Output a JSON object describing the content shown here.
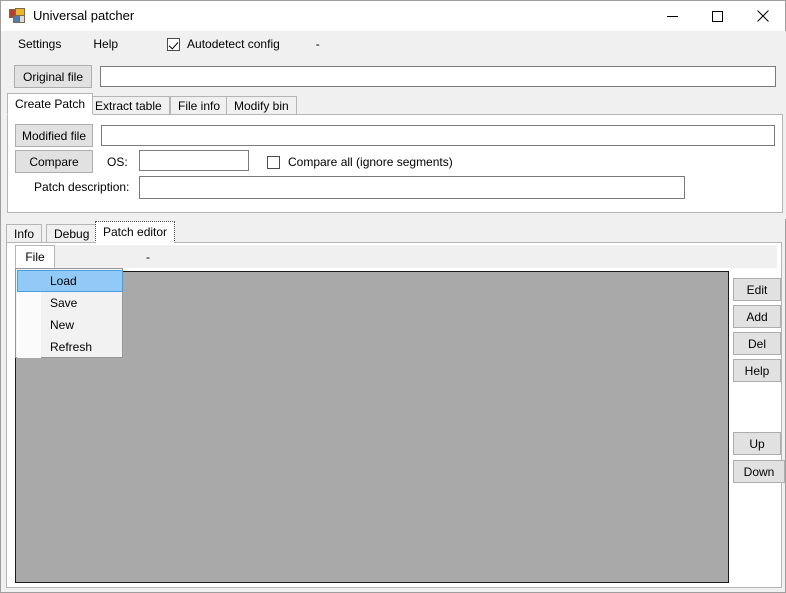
{
  "window": {
    "title": "Universal patcher",
    "icon": "app-icon",
    "controls": {
      "minimize": "minimize-icon",
      "maximize": "maximize-icon",
      "close": "close-icon"
    }
  },
  "menubar": {
    "items": [
      {
        "label": "Settings"
      },
      {
        "label": "Help"
      }
    ],
    "autodetect": {
      "label": "Autodetect config",
      "checked": true
    },
    "dash": "-"
  },
  "upper": {
    "original_file_button": "Original file",
    "original_file_value": "",
    "original_file_placeholder": "",
    "tabs": [
      {
        "label": "Create Patch",
        "selected": true
      },
      {
        "label": "Extract table",
        "selected": false
      },
      {
        "label": "File info",
        "selected": false
      },
      {
        "label": "Modify bin",
        "selected": false
      }
    ],
    "modified_file_button": "Modified file",
    "modified_file_value": "",
    "compare_button": "Compare",
    "os_label": "OS:",
    "os_value": "",
    "compare_all": {
      "label": "Compare all (ignore segments)",
      "checked": false
    },
    "patch_description_label": "Patch description:",
    "patch_description_value": ""
  },
  "lower": {
    "tabs": [
      {
        "label": "Info",
        "selected": false
      },
      {
        "label": "Debug",
        "selected": false
      },
      {
        "label": "Patch editor",
        "selected": true
      }
    ],
    "file_menu": {
      "label": "File",
      "dash": "-",
      "items": [
        {
          "label": "Load",
          "highlighted": true
        },
        {
          "label": "Save",
          "highlighted": false
        },
        {
          "label": "New",
          "highlighted": false
        },
        {
          "label": "Refresh",
          "highlighted": false
        }
      ]
    },
    "side_buttons": [
      {
        "label": "Edit"
      },
      {
        "label": "Add"
      },
      {
        "label": "Del"
      },
      {
        "label": "Help"
      },
      {
        "label": "Up"
      },
      {
        "label": "Down"
      }
    ],
    "list_content": ""
  },
  "colors": {
    "window_bg": "#f0f0f0",
    "panel_bg": "#ffffff",
    "list_bg": "#a9a9a9",
    "button_bg": "#e1e1e1",
    "highlight": "#91c9f7",
    "highlight_border": "#4a9fe0"
  }
}
